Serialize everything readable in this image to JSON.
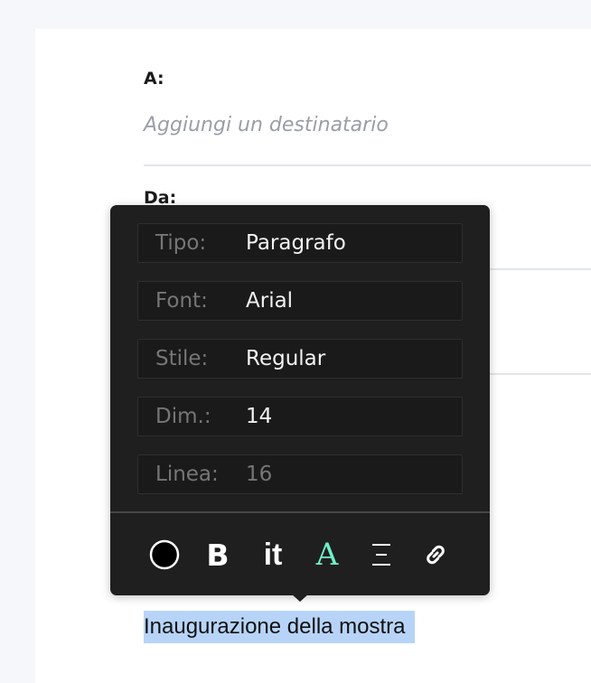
{
  "compose": {
    "to_label": "A:",
    "to_placeholder": "Aggiungi un destinatario",
    "from_label": "Da:",
    "body_text": "Inaugurazione della mostra"
  },
  "popover": {
    "rows": [
      {
        "label": "Tipo:",
        "value": "Paragrafo"
      },
      {
        "label": "Font:",
        "value": "Arial"
      },
      {
        "label": "Stile:",
        "value": "Regular"
      },
      {
        "label": "Dim.:",
        "value": "14"
      },
      {
        "label": "Linea:",
        "value": "16"
      }
    ],
    "toolbar": {
      "bold_label": "B",
      "italic_label": "it",
      "typeface_label": "A",
      "typeface_color": "#6ff0c6",
      "align_label": "Ξ",
      "color_icon": "circle-icon",
      "link_icon": "link-icon"
    }
  }
}
